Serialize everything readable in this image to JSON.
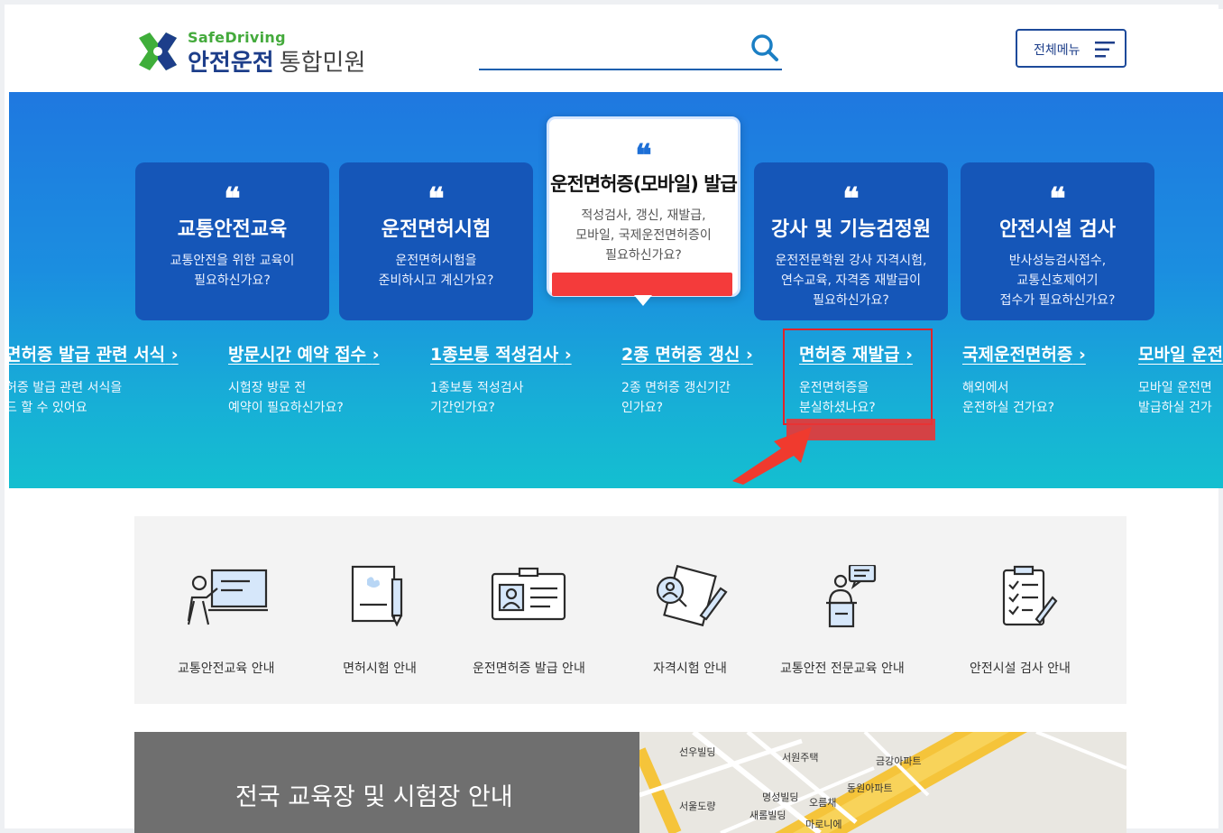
{
  "header": {
    "logo_en": "SafeDriving",
    "logo_ko_main": "안전운전",
    "logo_ko_sub": "통합민원",
    "search_value": "",
    "menu_label": "전체메뉴"
  },
  "hero": {
    "cards": [
      {
        "title": "교통안전교육",
        "desc": "교통안전을 위한 교육이\n필요하신가요?"
      },
      {
        "title": "운전면허시험",
        "desc": "운전면허시험을\n준비하시고 계신가요?"
      },
      {
        "title": "운전면허증(모바일) 발급",
        "desc": "적성검사, 갱신, 재발급,\n모바일, 국제운전면허증이\n필요하신가요?"
      },
      {
        "title": "강사 및 기능검정원",
        "desc": "운전전문학원 강사 자격시험,\n연수교육, 자격증 재발급이\n필요하신가요?"
      },
      {
        "title": "안전시설 검사",
        "desc": "반사성능검사접수,\n교통신호제어기\n접수가 필요하신가요?"
      }
    ],
    "quote_glyph": "❝",
    "links": [
      {
        "title": "면허증 발급 관련 서식",
        "desc": "허증 발급 관련 서식을\n드 할 수 있어요"
      },
      {
        "title": "방문시간 예약 접수",
        "desc": "시험장 방문 전\n예약이 필요하신가요?"
      },
      {
        "title": "1종보통 적성검사",
        "desc": "1종보통 적성검사\n기간인가요?"
      },
      {
        "title": "2종 면허증 갱신",
        "desc": "2종 면허증 갱신기간\n인가요?"
      },
      {
        "title": "면허증 재발급",
        "desc": "운전면허증을\n분실하셨나요?"
      },
      {
        "title": "국제운전면허증",
        "desc": "해외에서\n운전하실 건가요?"
      },
      {
        "title": "모바일 운전",
        "desc": "모바일 운전면\n발급하실 건가"
      }
    ],
    "chevron": "›"
  },
  "services": [
    {
      "label": "교통안전교육 안내"
    },
    {
      "label": "면허시험 안내"
    },
    {
      "label": "운전면허증 발급 안내"
    },
    {
      "label": "자격시험 안내"
    },
    {
      "label": "교통안전 전문교육 안내"
    },
    {
      "label": "안전시설 검사 안내"
    }
  ],
  "bottom": {
    "title": "전국 교육장 및 시험장 안내",
    "map_labels": [
      "선우빌딩",
      "서원주택",
      "금강아파트",
      "동원아파트",
      "서울도량",
      "명성빌딩",
      "오름채",
      "새롬빌딩",
      "마로니에"
    ]
  },
  "colors": {
    "brand_blue": "#1d3e8a",
    "brand_green": "#44aa3c",
    "card_blue": "#1556b8",
    "highlight_red": "#e0242a"
  }
}
